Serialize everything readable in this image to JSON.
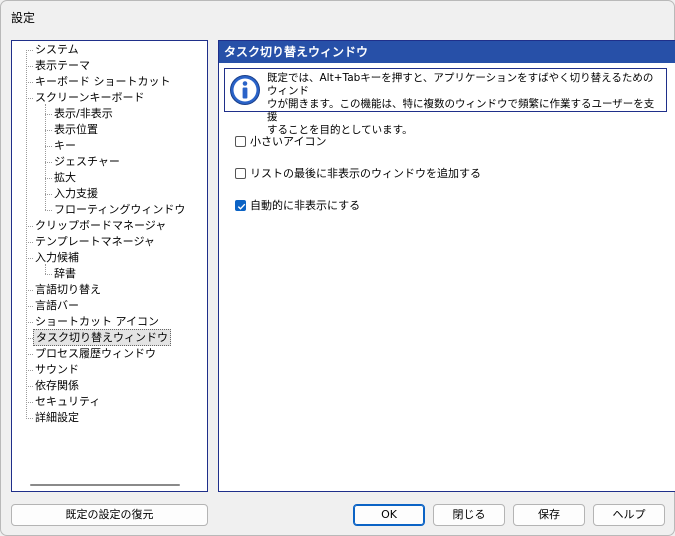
{
  "window": {
    "title": "設定"
  },
  "tree": {
    "items": [
      {
        "label": "システム",
        "level": 0
      },
      {
        "label": "表示テーマ",
        "level": 0
      },
      {
        "label": "キーボード ショートカット",
        "level": 0
      },
      {
        "label": "スクリーンキーボード",
        "level": 0
      },
      {
        "label": "表示/非表示",
        "level": 1
      },
      {
        "label": "表示位置",
        "level": 1
      },
      {
        "label": "キー",
        "level": 1
      },
      {
        "label": "ジェスチャー",
        "level": 1
      },
      {
        "label": "拡大",
        "level": 1
      },
      {
        "label": "入力支援",
        "level": 1
      },
      {
        "label": "フローティングウィンドウ",
        "level": 1
      },
      {
        "label": "クリップボードマネージャ",
        "level": 0
      },
      {
        "label": "テンプレートマネージャ",
        "level": 0
      },
      {
        "label": "入力候補",
        "level": 0
      },
      {
        "label": "辞書",
        "level": 1
      },
      {
        "label": "言語切り替え",
        "level": 0
      },
      {
        "label": "言語バー",
        "level": 0
      },
      {
        "label": "ショートカット アイコン",
        "level": 0
      },
      {
        "label": "タスク切り替えウィンドウ",
        "level": 0,
        "selected": true
      },
      {
        "label": "プロセス履歴ウィンドウ",
        "level": 0
      },
      {
        "label": "サウンド",
        "level": 0
      },
      {
        "label": "依存関係",
        "level": 0
      },
      {
        "label": "セキュリティ",
        "level": 0
      },
      {
        "label": "詳細設定",
        "level": 0
      }
    ]
  },
  "panel": {
    "title": "タスク切り替えウィンドウ",
    "info_line1": "既定では、Alt+Tabキーを押すと、アプリケーションをすばやく切り替えるためのウィンド",
    "info_line2": "ウが開きます。この機能は、特に複数のウィンドウで頻繁に作業するユーザーを支援",
    "info_line3": "することを目的としています。",
    "options": [
      {
        "label": "小さいアイコン",
        "checked": false
      },
      {
        "label": "リストの最後に非表示のウィンドウを追加する",
        "checked": false
      },
      {
        "label": "自動的に非表示にする",
        "checked": true
      }
    ]
  },
  "buttons": {
    "restore_defaults": "既定の設定の復元",
    "ok": "OK",
    "close": "閉じる",
    "save": "保存",
    "help": "ヘルプ"
  },
  "colors": {
    "header_bg": "#2750a8",
    "accent": "#0b63c5",
    "border": "#1f2f8a"
  }
}
